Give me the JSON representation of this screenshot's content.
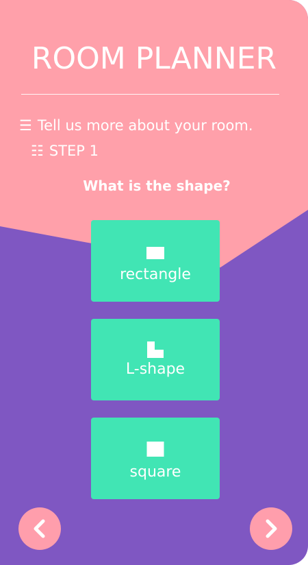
{
  "header": {
    "title": "ROOM PLANNER"
  },
  "intro": {
    "icon": "list-icon",
    "text": "Tell us more about your room."
  },
  "step": {
    "icon": "steps-icon",
    "text": "STEP 1"
  },
  "question": "What is the shape?",
  "shapes": [
    {
      "label": "rectangle",
      "icon": "rectangle-shape-icon"
    },
    {
      "label": "L-shape",
      "icon": "l-shape-icon"
    },
    {
      "label": "square",
      "icon": "square-shape-icon"
    }
  ],
  "navigation": {
    "prev_icon": "chevron-left-icon",
    "next_icon": "chevron-right-icon"
  },
  "colors": {
    "pink": "#ffa0aa",
    "purple": "#7f57c2",
    "mint": "#41e5b4",
    "nav_button": "#ff9eac",
    "text": "#ffffff"
  }
}
